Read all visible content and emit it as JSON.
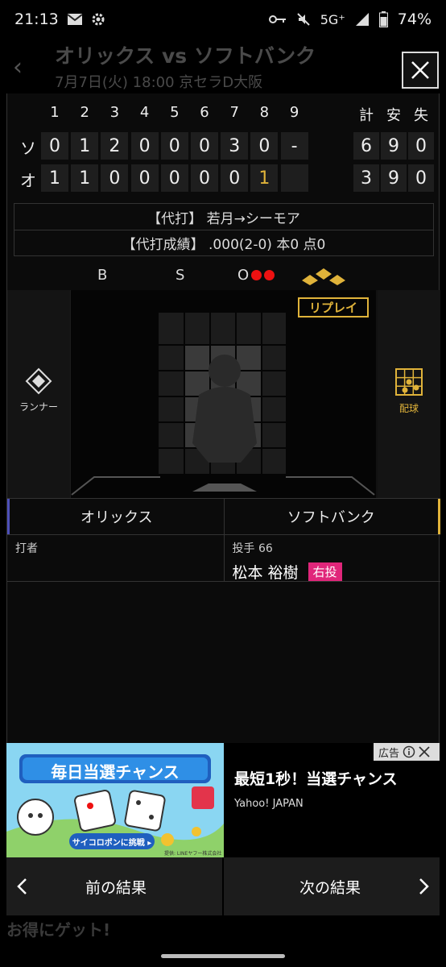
{
  "status_bar": {
    "time": "21:13",
    "network": "5G⁺",
    "battery": "74%"
  },
  "background_page": {
    "title": "オリックス vs ソフトバンク",
    "subtitle": "7月7日(火) 18:00 京セラD大阪",
    "promo_text": "お得にゲット!"
  },
  "scoreboard": {
    "innings": [
      "1",
      "2",
      "3",
      "4",
      "5",
      "6",
      "7",
      "8",
      "9"
    ],
    "total_headers": [
      "計",
      "安",
      "失"
    ],
    "teams": [
      {
        "mark": "ソ",
        "scores": [
          "0",
          "1",
          "2",
          "0",
          "0",
          "0",
          "3",
          "0",
          "-"
        ],
        "totals": [
          "6",
          "9",
          "0"
        ]
      },
      {
        "mark": "オ",
        "scores": [
          "1",
          "1",
          "0",
          "0",
          "0",
          "0",
          "0",
          "1",
          ""
        ],
        "totals": [
          "3",
          "9",
          "0"
        ]
      }
    ]
  },
  "pinch": {
    "line1": "【代打】 若月→シーモア",
    "line2": "【代打成績】 .000(2-0) 本0 点0"
  },
  "count": {
    "balls_label": "B",
    "strikes_label": "S",
    "outs_label": "O",
    "outs": 2
  },
  "field": {
    "replay_label": "リプレイ",
    "runner_label": "ランナー",
    "pitch_label": "配球"
  },
  "teams": {
    "home": "オリックス",
    "away": "ソフトバンク"
  },
  "players": {
    "batter_label": "打者",
    "pitcher_label": "投手 66",
    "pitcher_name": "松本 裕樹",
    "pitcher_hand": "右投"
  },
  "ad": {
    "image_title": "毎日当選チャンス",
    "image_button": "サイコロポンに挑戦 ▸",
    "image_credit": "提供: LINEヤフー株式会社",
    "headline": "最短1秒！当選チャンス",
    "source": "Yahoo! JAPAN",
    "label": "広告"
  },
  "nav": {
    "prev": "前の結果",
    "next": "次の結果"
  },
  "colors": {
    "accent_gold": "#e0b33a",
    "out_red": "#e11111",
    "pitcher_hand_pink": "#e0267a",
    "home_blue": "#4c4fb8"
  }
}
